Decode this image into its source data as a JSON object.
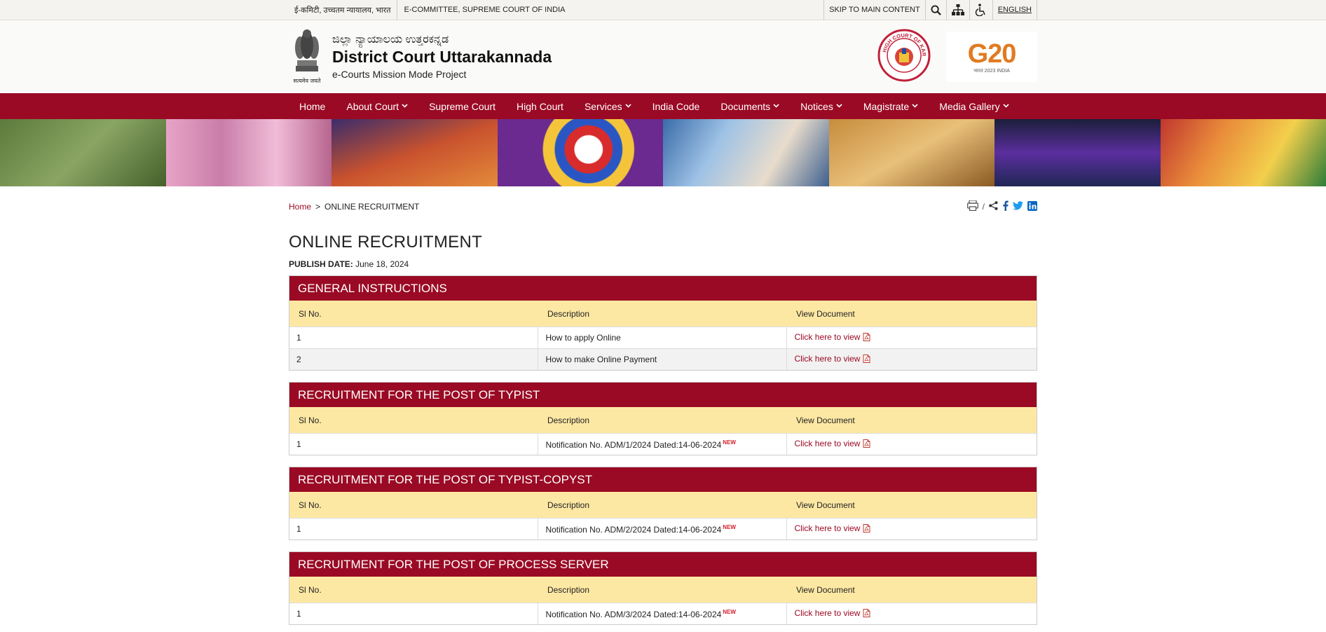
{
  "topbar": {
    "gov_label": "ई-कमिटी, उच्चतम न्यायालय, भारत",
    "ecommittee_label": "E-COMMITTEE, SUPREME COURT OF INDIA",
    "skip_label": "SKIP TO MAIN CONTENT",
    "language_label": "ENGLISH"
  },
  "header": {
    "title_kannada": "ಜಿಲ್ಲಾ ನ್ಯಾಯಾಲಯ ಉತ್ತರಕನ್ನಡ",
    "title": "District Court Uttarakannada",
    "subtitle": "e-Courts Mission Mode Project",
    "emblem_motto": "सत्यमेव जयते",
    "hc_logo_text": "HIGH COURT OF KARNATAKA",
    "g20_text": "G20",
    "g20_sub": "भारत 2023 INDIA"
  },
  "nav": [
    {
      "label": "Home",
      "dropdown": false
    },
    {
      "label": "About Court",
      "dropdown": true
    },
    {
      "label": "Supreme Court",
      "dropdown": false
    },
    {
      "label": "High Court",
      "dropdown": false
    },
    {
      "label": "Services",
      "dropdown": true
    },
    {
      "label": "India Code",
      "dropdown": false
    },
    {
      "label": "Documents",
      "dropdown": true
    },
    {
      "label": "Notices",
      "dropdown": true
    },
    {
      "label": "Magistrate",
      "dropdown": true
    },
    {
      "label": "Media Gallery",
      "dropdown": true
    }
  ],
  "breadcrumb": {
    "home": "Home",
    "separator": ">",
    "current": "ONLINE RECRUITMENT"
  },
  "page": {
    "title": "ONLINE RECRUITMENT",
    "publish_label": "PUBLISH DATE:",
    "publish_date": "June 18, 2024",
    "share_separator": "/"
  },
  "table_headers": {
    "col1": "Sl No.",
    "col2": "Description",
    "col3": "View Document"
  },
  "sections": [
    {
      "title": "GENERAL INSTRUCTIONS",
      "rows": [
        {
          "no": "1",
          "desc": "How to apply Online",
          "new": "",
          "link": "Click here to view"
        },
        {
          "no": "2",
          "desc": "How to make Online Payment",
          "new": "",
          "link": "Click here to view"
        }
      ]
    },
    {
      "title": "RECRUITMENT FOR THE POST OF TYPIST",
      "rows": [
        {
          "no": "1",
          "desc": "Notification No. ADM/1/2024 Dated:14-06-2024",
          "new": "NEW",
          "link": "Click here to view"
        }
      ]
    },
    {
      "title": "RECRUITMENT FOR THE POST OF TYPIST-COPYST",
      "rows": [
        {
          "no": "1",
          "desc": "Notification No. ADM/2/2024 Dated:14-06-2024",
          "new": "NEW",
          "link": "Click here to view"
        }
      ]
    },
    {
      "title": "RECRUITMENT FOR THE POST OF PROCESS SERVER",
      "rows": [
        {
          "no": "1",
          "desc": "Notification No. ADM/3/2024 Dated:14-06-2024",
          "new": "NEW",
          "link": "Click here to view"
        }
      ]
    }
  ],
  "colors": {
    "primary": "#9a0a24",
    "table_header": "#fde8a3",
    "new_badge": "#d4202a"
  },
  "icons": [
    "search-icon",
    "sitemap-icon",
    "accessibility-icon",
    "print-icon",
    "share-icon",
    "facebook-icon",
    "twitter-icon",
    "linkedin-icon",
    "pdf-icon"
  ]
}
